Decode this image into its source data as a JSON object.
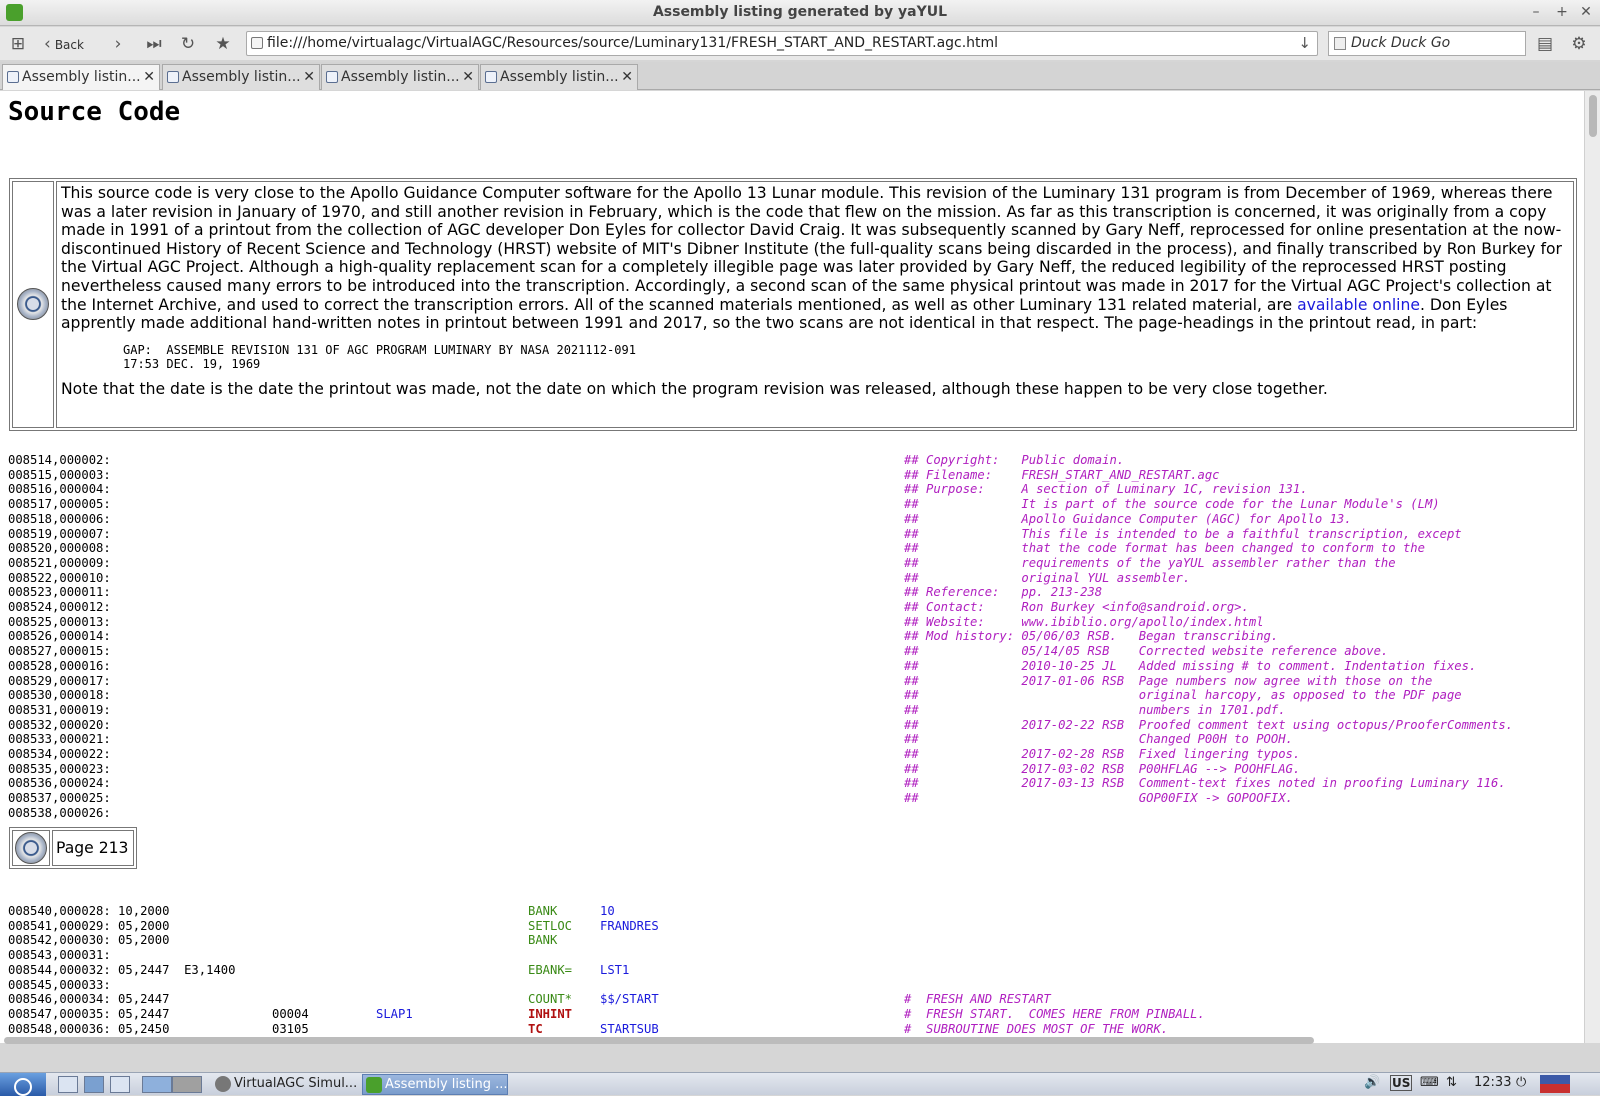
{
  "window": {
    "title": "Assembly listing generated by yaYUL"
  },
  "nav": {
    "back_label": "Back",
    "url": "file:///home/virtualagc/VirtualAGC/Resources/source/Luminary131/FRESH_START_AND_RESTART.agc.html",
    "search_placeholder": "Duck Duck Go"
  },
  "tabs": [
    {
      "label": "Assembly listin...",
      "active": true
    },
    {
      "label": "Assembly listin...",
      "active": false
    },
    {
      "label": "Assembly listin...",
      "active": false
    },
    {
      "label": "Assembly listin...",
      "active": false
    }
  ],
  "page": {
    "heading": "Source Code",
    "note": {
      "para1_a": "This source code is very close to the Apollo Guidance Computer software for the Apollo 13 Lunar module. This revision of the Luminary 131 program is from December of 1969, whereas there was a later revision in January of 1970, and still another revision in February, which is the code that flew on the mission. As far as this transcription is concerned, it was originally from a copy made in 1991 of a printout from the collection of AGC developer Don Eyles for collector David Craig. It was subsequently scanned by Gary Neff, reprocessed for online presentation at the now-discontinued History of Recent Science and Technology (HRST) website of MIT's Dibner Institute (the full-quality scans being discarded in the process), and finally transcribed by Ron Burkey for the Virtual AGC Project. Although a high-quality replacement scan for a completely illegible page was later provided by Gary Neff, the reduced legibility of the reprocessed HRST posting nevertheless caused many errors to be introduced into the transcription. Accordingly, a second scan of the same physical printout was made in 2017 for the Virtual AGC Project's collection at the Internet Archive, and used to correct the transcription errors. All of the scanned materials mentioned, as well as other Luminary 131 related material, are ",
      "link": "available online",
      "para1_b": ". Don Eyles apprently made additional hand-written notes in printout between 1991 and 2017, so the two scans are not identical in that respect. The page-headings in the printout read, in part:",
      "pre": "GAP:  ASSEMBLE REVISION 131 OF AGC PROGRAM LUMINARY BY NASA 2021112-091\n17:53 DEC. 19, 1969",
      "para2": "Note that the date is the date the printout was made, not the date on which the program revision was released, although these happen to be very close together."
    },
    "header_lines": "008514,000002:\n008515,000003:\n008516,000004:\n008517,000005:\n008518,000006:\n008519,000007:\n008520,000008:\n008521,000009:\n008522,000010:\n008523,000011:\n008524,000012:\n008525,000013:\n008526,000014:\n008527,000015:\n008528,000016:\n008529,000017:\n008530,000018:\n008531,000019:\n008532,000020:\n008533,000021:\n008534,000022:\n008535,000023:\n008536,000024:\n008537,000025:\n008538,000026:",
    "header_comments": "## Copyright:   Public domain.\n## Filename:    FRESH_START_AND_RESTART.agc\n## Purpose:     A section of Luminary 1C, revision 131.\n##              It is part of the source code for the Lunar Module's (LM)\n##              Apollo Guidance Computer (AGC) for Apollo 13.\n##              This file is intended to be a faithful transcription, except\n##              that the code format has been changed to conform to the\n##              requirements of the yaYUL assembler rather than the\n##              original YUL assembler.\n## Reference:   pp. 213-238\n## Contact:     Ron Burkey <info@sandroid.org>.\n## Website:     www.ibiblio.org/apollo/index.html\n## Mod history: 05/06/03 RSB.   Began transcribing.\n##              05/14/05 RSB    Corrected website reference above.\n##              2010-10-25 JL   Added missing # to comment. Indentation fixes.\n##              2017-01-06 RSB  Page numbers now agree with those on the\n##                              original harcopy, as opposed to the PDF page\n##                              numbers in 1701.pdf.\n##              2017-02-22 RSB  Proofed comment text using octopus/ProoferComments.\n##                              Changed P00H to POOH.\n##              2017-02-28 RSB  Fixed lingering typos.\n##              2017-03-02 RSB  P00HFLAG --> POOHFLAG.\n##              2017-03-13 RSB  Comment-text fixes noted in proofing Luminary 116.\n##                              GOP00FIX -> GOPOOFIX.",
    "page_label": "Page 213",
    "code_addr": "008540,000028: 10,2000\n008541,000029: 05,2000\n008542,000030: 05,2000\n008543,000031:\n008544,000032: 05,2447  E3,1400\n008545,000033:\n008546,000034: 05,2447\n008547,000035: 05,2447\n008548,000036: 05,2450",
    "code_octal": "\n\n\n\n\n\n\n00004\n03105",
    "code_label": "\n\n\n\n\n\n\nSLAP1\n",
    "code_ops": [
      {
        "op": "BANK",
        "operand": "10",
        "kind": "green"
      },
      {
        "op": "SETLOC",
        "operand": "FRANDRES",
        "kind": "green"
      },
      {
        "op": "BANK",
        "operand": "",
        "kind": "green"
      },
      {
        "op": "",
        "operand": "",
        "kind": "green"
      },
      {
        "op": "EBANK=",
        "operand": "LST1",
        "kind": "green"
      },
      {
        "op": "",
        "operand": "",
        "kind": "green"
      },
      {
        "op": "COUNT*",
        "operand": "$$/START",
        "kind": "green"
      },
      {
        "op": "INHINT",
        "operand": "",
        "kind": "red"
      },
      {
        "op": "TC",
        "operand": "STARTSUB",
        "kind": "red"
      }
    ],
    "code_comments": "\n\n\n\n\n\n#  FRESH AND RESTART\n#  FRESH START.  COMES HERE FROM PINBALL.\n#  SUBROUTINE DOES MOST OF THE WORK."
  },
  "taskbar": {
    "tasks": [
      {
        "label": "VirtualAGC Simul...",
        "active": false
      },
      {
        "label": "Assembly listing ...",
        "active": true
      }
    ],
    "keyboard": "US",
    "clock": "12:33"
  }
}
